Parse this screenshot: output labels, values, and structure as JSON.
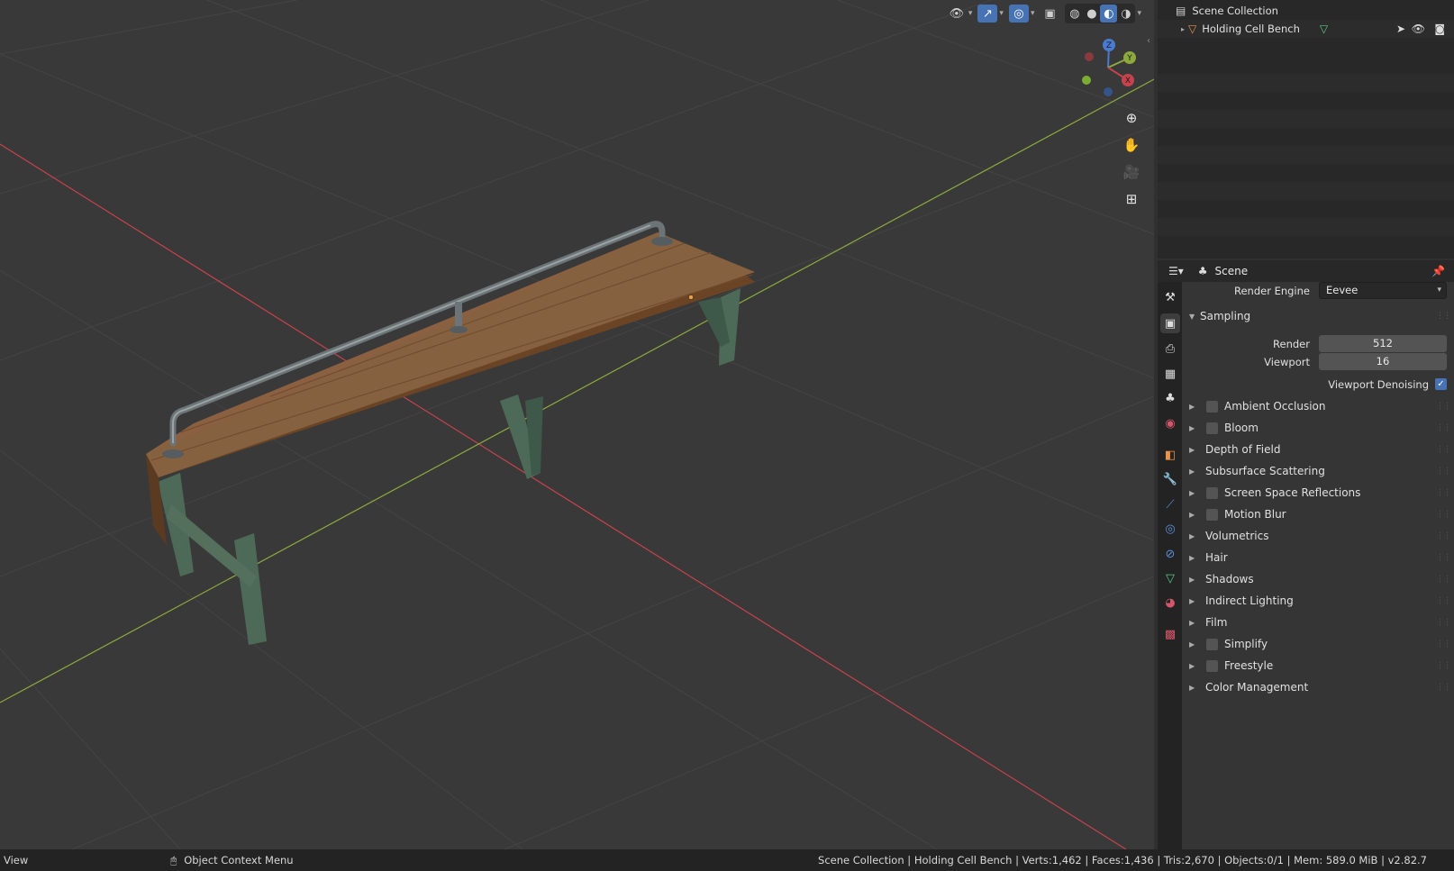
{
  "viewport": {
    "header_icons": [
      "visibility-icon",
      "gizmo-icon",
      "overlay-icon",
      "xray-icon",
      "wireframe-icon",
      "solid-icon",
      "material-preview-icon",
      "rendered-icon"
    ],
    "gizmo_axes": {
      "z": "Z",
      "y": "Y",
      "x": "X"
    },
    "nav_tools": [
      "zoom-icon",
      "hand-pan-icon",
      "camera-icon",
      "perspective-grid-icon"
    ],
    "colors": {
      "x_axis": "#c6424c",
      "y_axis": "#8cab3c",
      "background": "#393939"
    }
  },
  "outliner": {
    "root_label": "Scene Collection",
    "object_label": "Holding Cell Bench"
  },
  "properties": {
    "context_label": "Scene",
    "render_engine_label": "Render Engine",
    "render_engine_value": "Eevee",
    "sampling": {
      "title": "Sampling",
      "render_label": "Render",
      "render_value": "512",
      "viewport_label": "Viewport",
      "viewport_value": "16",
      "denoise_label": "Viewport Denoising",
      "denoise_checked": true
    },
    "panels": [
      {
        "label": "Ambient Occlusion",
        "checkbox": true
      },
      {
        "label": "Bloom",
        "checkbox": true
      },
      {
        "label": "Depth of Field",
        "checkbox": false
      },
      {
        "label": "Subsurface Scattering",
        "checkbox": false
      },
      {
        "label": "Screen Space Reflections",
        "checkbox": true
      },
      {
        "label": "Motion Blur",
        "checkbox": true
      },
      {
        "label": "Volumetrics",
        "checkbox": false
      },
      {
        "label": "Hair",
        "checkbox": false
      },
      {
        "label": "Shadows",
        "checkbox": false
      },
      {
        "label": "Indirect Lighting",
        "checkbox": false
      },
      {
        "label": "Film",
        "checkbox": false
      },
      {
        "label": "Simplify",
        "checkbox": true
      },
      {
        "label": "Freestyle",
        "checkbox": true
      },
      {
        "label": "Color Management",
        "checkbox": false
      }
    ],
    "tabs": [
      "tool-icon",
      "render-icon",
      "output-icon",
      "view-layer-icon",
      "scene-icon",
      "world-icon",
      "object-icon",
      "modifier-icon",
      "particles-icon",
      "physics-icon",
      "constraints-icon",
      "data-icon",
      "material-icon",
      "texture-icon"
    ]
  },
  "statusbar": {
    "left_label": "View",
    "context_label": "Object Context Menu",
    "info": "Scene Collection | Holding Cell Bench | Verts:1,462 | Faces:1,436 | Tris:2,670 | Objects:0/1 | Mem: 589.0 MiB | v2.82.7"
  }
}
